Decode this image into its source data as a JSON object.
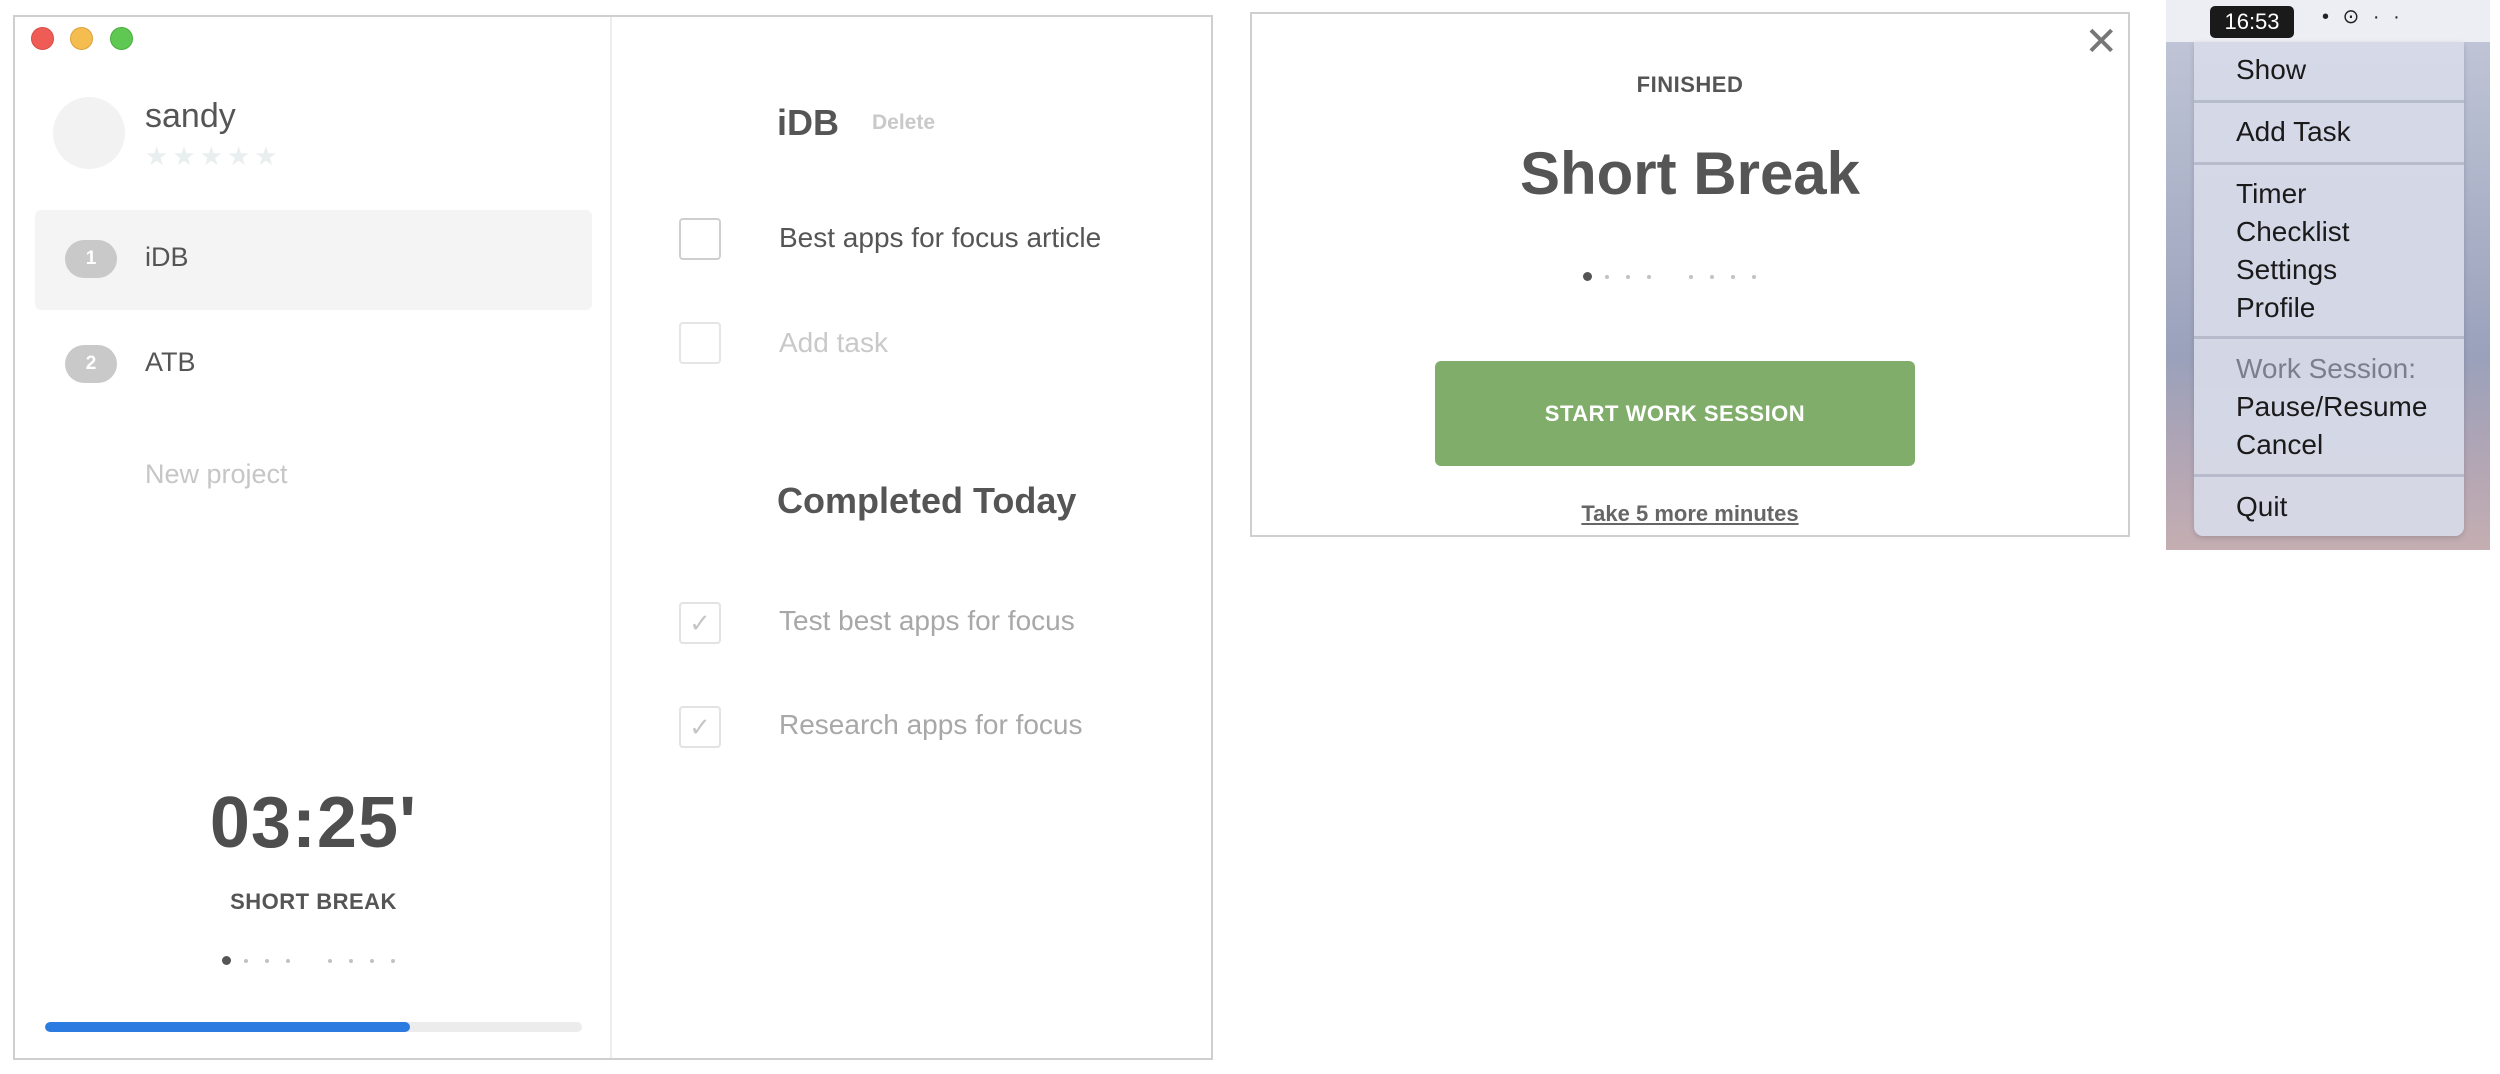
{
  "main_window": {
    "sidebar": {
      "user_name": "sandy",
      "rating": {
        "stars": [
          "★",
          "★",
          "★",
          "★",
          "★"
        ],
        "filled": 0
      },
      "projects": [
        {
          "number": "1",
          "label": "iDB",
          "active": true
        },
        {
          "number": "2",
          "label": "ATB",
          "active": false
        }
      ],
      "new_project": "New project",
      "timer": "03:25'",
      "timer_mode": "SHORT BREAK",
      "session_progress": 0.68
    },
    "task_pane": {
      "project_title": "iDB",
      "delete_label": "Delete",
      "tasks": [
        {
          "label": "Best apps for focus article"
        }
      ],
      "add_task_placeholder": "Add task",
      "completed_title": "Completed Today",
      "completed_tasks": [
        {
          "label": "Test best apps for focus",
          "check": "✓"
        },
        {
          "label": "Research apps for focus",
          "check": "✓"
        }
      ]
    }
  },
  "finished_dialog": {
    "close_glyph": "✕",
    "status": "FINISHED",
    "title": "Short Break",
    "primary_button": "START WORK SESSION",
    "secondary_link": "Take 5 more minutes"
  },
  "menubar": {
    "clock": "16:53",
    "status_icons": "• ⊙ · ·",
    "menu": {
      "show": "Show",
      "add_task": "Add Task",
      "timer": "Timer",
      "checklist": "Checklist",
      "settings": "Settings",
      "profile": "Profile",
      "work_session_header": "Work Session:",
      "pause_resume": "Pause/Resume",
      "cancel": "Cancel",
      "quit": "Quit"
    }
  },
  "colors": {
    "accent_green": "#80ae6a",
    "progress_blue": "#2b7be0",
    "close_red": "#ee5c55",
    "minimize_yellow": "#f5bd4f",
    "zoom_green": "#5fc853"
  }
}
